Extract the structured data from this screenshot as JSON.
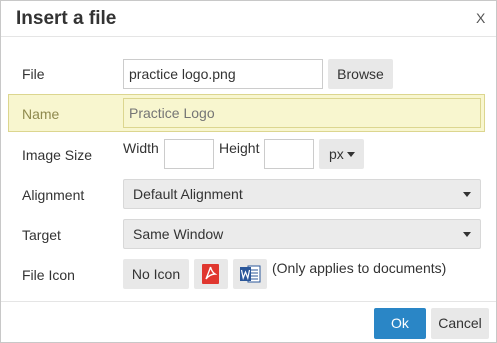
{
  "dialog": {
    "title": "Insert a file",
    "close_label": "X"
  },
  "form": {
    "file": {
      "label": "File",
      "value": "practice logo.png",
      "browse_label": "Browse"
    },
    "name": {
      "label": "Name",
      "placeholder": "Practice Logo"
    },
    "image_size": {
      "label": "Image Size",
      "width_label": "Width",
      "height_label": "Height",
      "width_value": "",
      "height_value": "",
      "unit_value": "px"
    },
    "alignment": {
      "label": "Alignment",
      "selected": "Default Alignment"
    },
    "target": {
      "label": "Target",
      "selected": "Same Window"
    },
    "file_icon": {
      "label": "File Icon",
      "no_icon_label": "No Icon",
      "note": "(Only applies to documents)",
      "icons": [
        "pdf-icon",
        "word-icon"
      ]
    }
  },
  "footer": {
    "ok_label": "Ok",
    "cancel_label": "Cancel"
  },
  "colors": {
    "primary": "#2a86c6",
    "highlight_bg": "#f8f6cf",
    "highlight_border": "#dcd68f",
    "pdf_red": "#e0372f",
    "word_blue": "#2b579a"
  }
}
